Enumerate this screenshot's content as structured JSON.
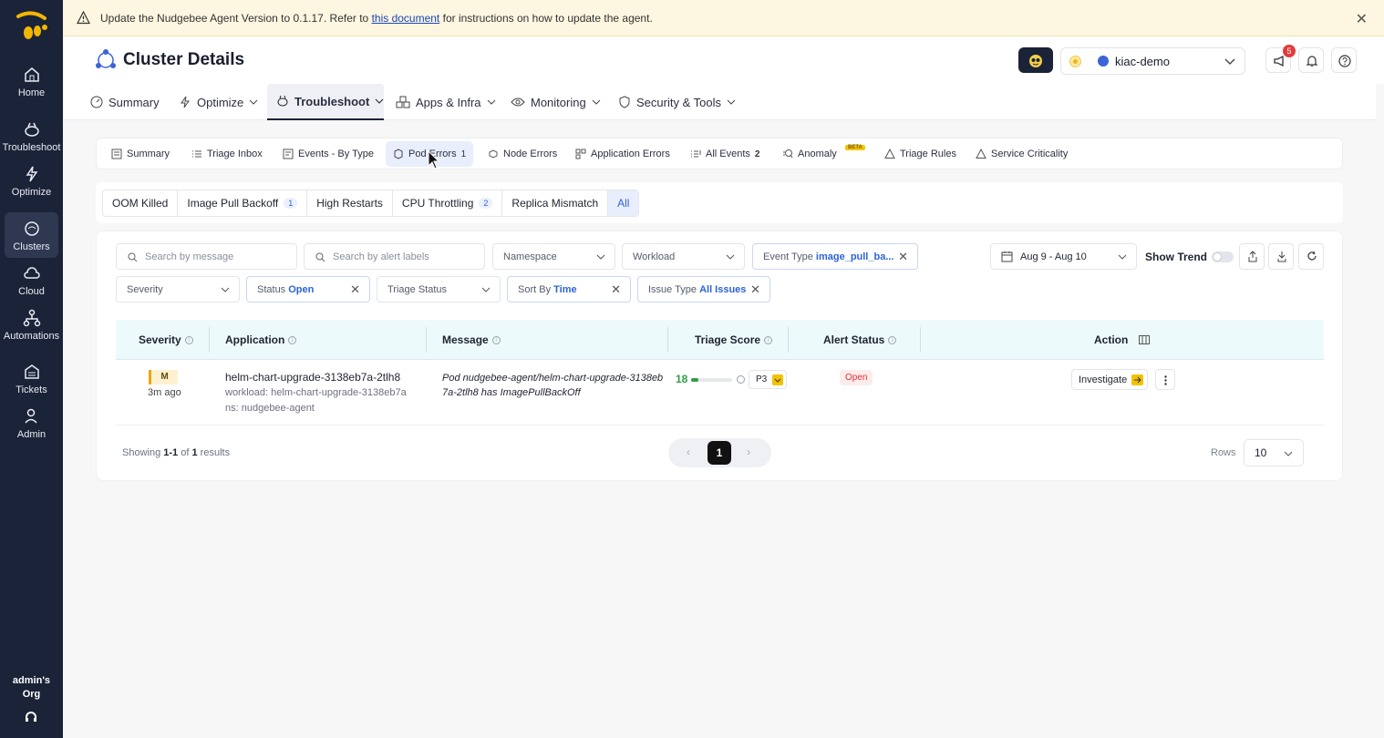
{
  "nav": {
    "items": [
      {
        "label": "Home",
        "icon": "home-icon"
      },
      {
        "label": "Troubleshoot",
        "icon": "bee-troubleshoot-icon"
      },
      {
        "label": "Optimize",
        "icon": "bolt-icon"
      },
      {
        "label": "Clusters",
        "icon": "clusters-icon"
      },
      {
        "label": "Cloud",
        "icon": "cloud-icon"
      },
      {
        "label": "Automations",
        "icon": "automations-icon"
      },
      {
        "label": "Tickets",
        "icon": "tickets-icon"
      },
      {
        "label": "Admin",
        "icon": "admin-icon"
      }
    ],
    "active": "Clusters",
    "org_line1": "admin's",
    "org_line2": "Org"
  },
  "banner": {
    "text_before": "Update the Nudgebee Agent Version to 0.1.17. Refer to",
    "link": "this document",
    "text_after": "for instructions on how to update the agent.",
    "close": "✕"
  },
  "header": {
    "title": "Cluster Details",
    "cluster": "kiac-demo",
    "notification_count": "5"
  },
  "main_tabs": [
    {
      "label": "Summary"
    },
    {
      "label": "Optimize"
    },
    {
      "label": "Troubleshoot"
    },
    {
      "label": "Apps & Infra"
    },
    {
      "label": "Monitoring"
    },
    {
      "label": "Security & Tools"
    }
  ],
  "sub_tabs": [
    {
      "label": "Summary",
      "count": ""
    },
    {
      "label": "Triage Inbox",
      "count": ""
    },
    {
      "label": "Events - By Type",
      "count": ""
    },
    {
      "label": "Pod Errors",
      "count": "1"
    },
    {
      "label": "Node Errors",
      "count": ""
    },
    {
      "label": "Application Errors",
      "count": ""
    },
    {
      "label": "All Events",
      "count": "2"
    },
    {
      "label": "Anomaly",
      "count": "",
      "tag": "BETA"
    },
    {
      "label": "Triage Rules",
      "count": ""
    },
    {
      "label": "Service Criticality",
      "count": ""
    }
  ],
  "chips": [
    {
      "label": "OOM Killed",
      "count": ""
    },
    {
      "label": "Image Pull Backoff",
      "count": "1"
    },
    {
      "label": "High Restarts",
      "count": ""
    },
    {
      "label": "CPU Throttling",
      "count": "2"
    },
    {
      "label": "Replica Mismatch",
      "count": ""
    },
    {
      "label": "All",
      "count": ""
    }
  ],
  "filters": {
    "search_message_placeholder": "Search by message",
    "search_labels_placeholder": "Search by alert labels",
    "namespace": "Namespace",
    "workload": "Workload",
    "event_type_label": "Event Type",
    "event_type_value": "image_pull_ba...",
    "date_range": "Aug 9 - Aug 10",
    "show_trend": "Show Trend",
    "severity": "Severity",
    "status_label": "Status",
    "status_value": "Open",
    "triage_status": "Triage Status",
    "sort_label": "Sort By",
    "sort_value": "Time",
    "issue_type_label": "Issue Type",
    "issue_type_value": "All Issues"
  },
  "table": {
    "columns": [
      "Severity",
      "Application",
      "Message",
      "Triage Score",
      "Alert Status",
      "Action"
    ],
    "rows": [
      {
        "severity": "M",
        "age": "3m ago",
        "app": "helm-chart-upgrade-3138eb7a-2tlh8",
        "workload": "workload: helm-chart-upgrade-3138eb7a",
        "ns": "ns: nudgebee-agent",
        "message_line1": "Pod nudgebee-agent/helm-chart-upgrade-3138eb",
        "message_line2": "7a-2tlh8 has ImagePullBackOff",
        "score": "18",
        "score_fraction": 0.18,
        "priority": "P3",
        "status": "Open",
        "action": "Investigate"
      }
    ]
  },
  "footer": {
    "showing_prefix": "Showing",
    "showing_range": "1-1",
    "of": "of",
    "total": "1",
    "results": "results",
    "page": "1",
    "rows_label": "Rows",
    "rows_value": "10"
  }
}
